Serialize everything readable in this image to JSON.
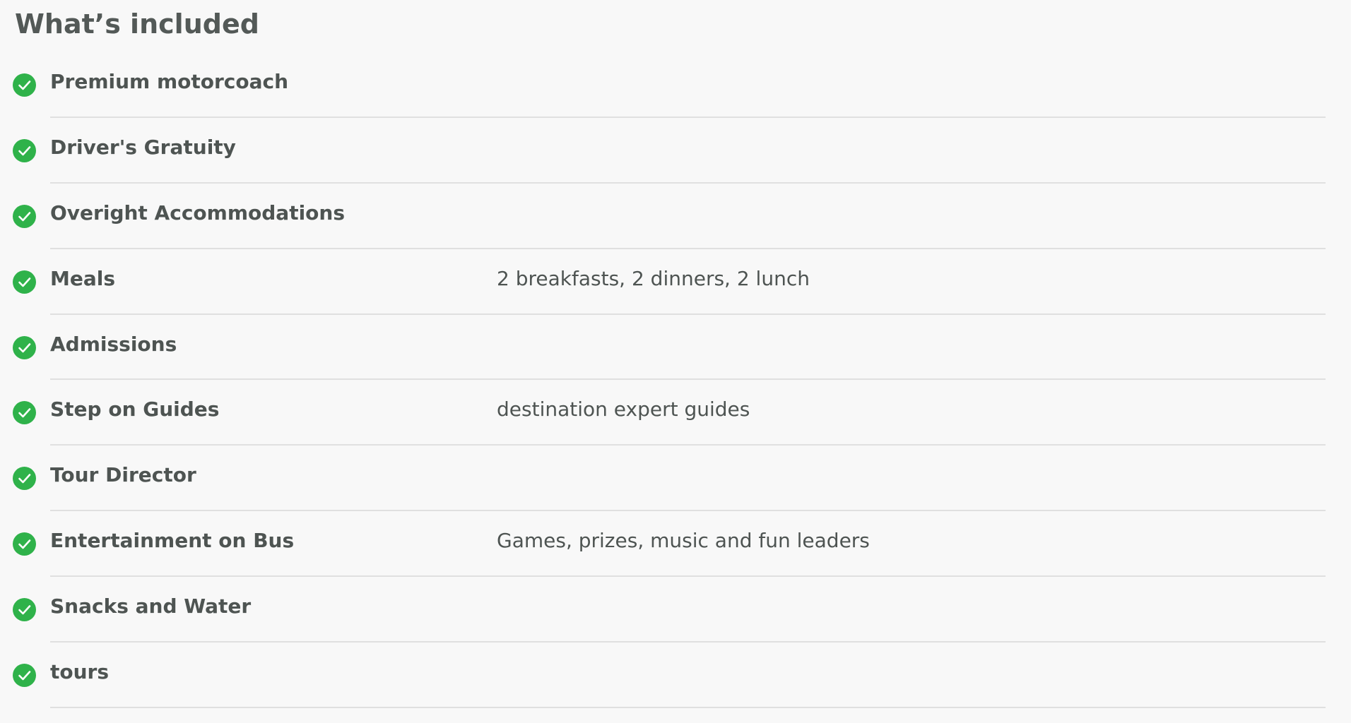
{
  "section": {
    "title": "What’s included"
  },
  "colors": {
    "check": "#2fb24a",
    "text": "#4e5452",
    "divider": "#e0e0e0",
    "background": "#f8f8f8"
  },
  "items": [
    {
      "icon": "check-circle-icon",
      "name": "Premium motorcoach",
      "detail": ""
    },
    {
      "icon": "check-circle-icon",
      "name": "Driver's Gratuity",
      "detail": ""
    },
    {
      "icon": "check-circle-icon",
      "name": "Overight Accommodations",
      "detail": ""
    },
    {
      "icon": "check-circle-icon",
      "name": "Meals",
      "detail": "2 breakfasts, 2 dinners, 2 lunch"
    },
    {
      "icon": "check-circle-icon",
      "name": "Admissions",
      "detail": ""
    },
    {
      "icon": "check-circle-icon",
      "name": "Step on Guides",
      "detail": "destination expert guides"
    },
    {
      "icon": "check-circle-icon",
      "name": "Tour Director",
      "detail": ""
    },
    {
      "icon": "check-circle-icon",
      "name": "Entertainment on Bus",
      "detail": "Games, prizes, music and fun leaders"
    },
    {
      "icon": "check-circle-icon",
      "name": "Snacks and Water",
      "detail": ""
    },
    {
      "icon": "check-circle-icon",
      "name": "tours",
      "detail": ""
    }
  ]
}
